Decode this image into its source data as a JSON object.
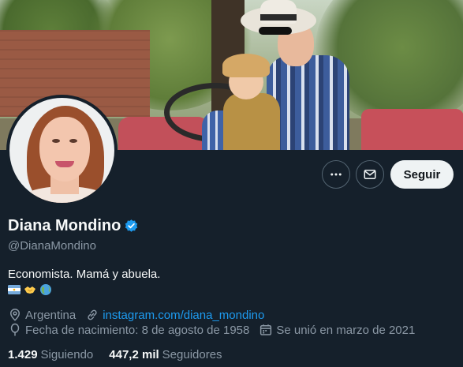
{
  "profile": {
    "name": "Diana Mondino",
    "handle": "@DianaMondino",
    "bio": "Economista. Mamá y abuela.",
    "bio_emojis": [
      "argentina-flag-emoji",
      "handshake-emoji",
      "globe-emoji"
    ],
    "location": "Argentina",
    "website": "instagram.com/diana_mondino",
    "birthdate": "Fecha de nacimiento: 8 de agosto de 1958",
    "joined": "Se unió en marzo de 2021"
  },
  "actions": {
    "more_icon": "more-icon",
    "message_icon": "envelope-icon",
    "follow_label": "Seguir"
  },
  "stats": {
    "following_count": "1.429",
    "following_label": "Siguiendo",
    "followers_count": "447,2 mil",
    "followers_label": "Seguidores"
  },
  "colors": {
    "background": "#15202b",
    "accent": "#1d9bf0",
    "secondary_text": "#8b98a5",
    "follow_button_bg": "#eff3f4"
  }
}
